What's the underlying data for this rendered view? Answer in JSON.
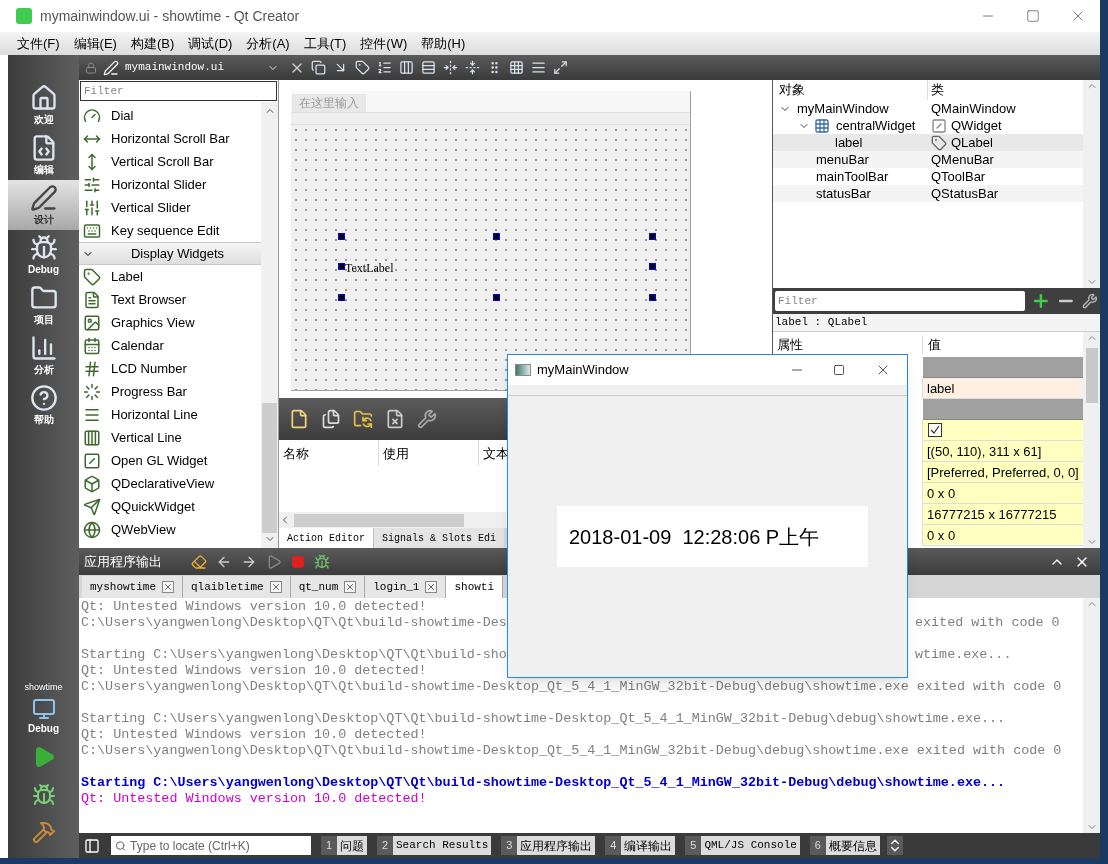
{
  "window": {
    "title": "mymainwindow.ui - showtime - Qt Creator"
  },
  "menu": [
    "文件(F)",
    "编辑(E)",
    "构建(B)",
    "调试(D)",
    "分析(A)",
    "工具(T)",
    "控件(W)",
    "帮助(H)"
  ],
  "mode_bar": {
    "items": [
      {
        "label": "欢迎",
        "selected": false
      },
      {
        "label": "编辑",
        "selected": false
      },
      {
        "label": "设计",
        "selected": true
      },
      {
        "label": "Debug",
        "selected": false
      },
      {
        "label": "项目",
        "selected": false
      },
      {
        "label": "分析",
        "selected": false
      },
      {
        "label": "帮助",
        "selected": false
      }
    ],
    "kit": {
      "project": "showtime",
      "config": "Debug"
    }
  },
  "editor_toolbar": {
    "file": "mymainwindow.ui"
  },
  "widget_box": {
    "filter": {
      "placeholder": "Filter"
    },
    "items": [
      {
        "kind": "widget",
        "label": "Dial"
      },
      {
        "kind": "widget",
        "label": "Horizontal Scroll Bar"
      },
      {
        "kind": "widget",
        "label": "Vertical Scroll Bar"
      },
      {
        "kind": "widget",
        "label": "Horizontal Slider"
      },
      {
        "kind": "widget",
        "label": "Vertical Slider"
      },
      {
        "kind": "widget",
        "label": "Key sequence Edit"
      },
      {
        "kind": "category",
        "label": "Display Widgets",
        "expanded": true
      },
      {
        "kind": "widget",
        "label": "Label"
      },
      {
        "kind": "widget",
        "label": "Text Browser"
      },
      {
        "kind": "widget",
        "label": "Graphics View"
      },
      {
        "kind": "widget",
        "label": "Calendar"
      },
      {
        "kind": "widget",
        "label": "LCD Number"
      },
      {
        "kind": "widget",
        "label": "Progress Bar"
      },
      {
        "kind": "widget",
        "label": "Horizontal Line"
      },
      {
        "kind": "widget",
        "label": "Vertical Line"
      },
      {
        "kind": "widget",
        "label": "Open GL Widget"
      },
      {
        "kind": "widget",
        "label": "QDeclarativeView"
      },
      {
        "kind": "widget",
        "label": "QQuickWidget"
      },
      {
        "kind": "widget",
        "label": "QWebView"
      }
    ]
  },
  "form": {
    "menu_placeholder": "在这里输入",
    "label_text": "TextLabel"
  },
  "action_editor": {
    "columns": [
      "名称",
      "使用",
      "文本"
    ],
    "tabs": [
      {
        "label": "Action Editor",
        "selected": true
      },
      {
        "label": "Signals & Slots Edi",
        "selected": false
      }
    ]
  },
  "object_inspector": {
    "columns": [
      "对象",
      "类"
    ],
    "items": [
      {
        "name": "myMainWindow",
        "class": "QMainWindow",
        "expanded": true,
        "selected": false,
        "children": [
          {
            "name": "centralWidget",
            "class": "QWidget",
            "expanded": true,
            "selected": false,
            "children": [
              {
                "name": "label",
                "class": "QLabel",
                "selected": true
              }
            ]
          },
          {
            "name": "menuBar",
            "class": "QMenuBar",
            "selected": false
          },
          {
            "name": "mainToolBar",
            "class": "QToolBar",
            "selected": false
          },
          {
            "name": "statusBar",
            "class": "QStatusBar",
            "selected": false
          }
        ]
      }
    ]
  },
  "property_editor": {
    "filter": {
      "placeholder": "Filter"
    },
    "object": "label : QLabel",
    "columns": [
      "属性",
      "值"
    ],
    "rows": [
      {
        "kind": "group"
      },
      {
        "kind": "value",
        "value": "label",
        "color": "#fdefe2"
      },
      {
        "kind": "group"
      },
      {
        "kind": "checkbox",
        "checked": true,
        "color": "#ffffc0"
      },
      {
        "kind": "value",
        "value": "[(50, 110), 311 x 61]",
        "color": "#ffffc0"
      },
      {
        "kind": "value",
        "value": "[Preferred, Preferred, 0, 0]",
        "color": "#ffffc0"
      },
      {
        "kind": "value",
        "value": "0 x 0",
        "color": "#ffffc0"
      },
      {
        "kind": "value",
        "value": "16777215 x 16777215",
        "color": "#ffffc0"
      },
      {
        "kind": "value",
        "value": "0 x 0",
        "color": "#ffffc0"
      }
    ]
  },
  "output": {
    "title": "应用程序输出",
    "tabs": [
      {
        "label": "myshowtime",
        "selected": false
      },
      {
        "label": "qlaibletime",
        "selected": false
      },
      {
        "label": "qt_num",
        "selected": false
      },
      {
        "label": "login_1",
        "selected": false
      },
      {
        "label": "showti",
        "selected": true
      }
    ],
    "lines": [
      {
        "kind": "text",
        "text": "Qt: Untested Windows version 10.0 detected!",
        "color": "#808080"
      },
      {
        "kind": "text",
        "text": "C:\\Users\\yangwenlong\\Desktop\\QT\\Qt\\build-showtime-Des",
        "right_text": "exited with code 0",
        "color": "#808080"
      },
      {
        "kind": "blank"
      },
      {
        "kind": "text",
        "text": "Starting C:\\Users\\yangwenlong\\Desktop\\QT\\Qt\\build-sho",
        "right_text": "wtime.exe...",
        "color": "#808080"
      },
      {
        "kind": "text",
        "text": "Qt: Untested Windows version 10.0 detected!",
        "color": "#808080"
      },
      {
        "kind": "text",
        "text": "C:\\Users\\yangwenlong\\Desktop\\QT\\Qt\\build-showtime-Desktop_Qt_5_4_1_MinGW_32bit-Debug\\debug\\showtime.exe exited with code 0",
        "color": "#808080"
      },
      {
        "kind": "blank"
      },
      {
        "kind": "text",
        "text": "Starting C:\\Users\\yangwenlong\\Desktop\\QT\\Qt\\build-showtime-Desktop_Qt_5_4_1_MinGW_32bit-Debug\\debug\\showtime.exe...",
        "color": "#808080"
      },
      {
        "kind": "text",
        "text": "Qt: Untested Windows version 10.0 detected!",
        "color": "#808080"
      },
      {
        "kind": "text",
        "text": "C:\\Users\\yangwenlong\\Desktop\\QT\\Qt\\build-showtime-Desktop_Qt_5_4_1_MinGW_32bit-Debug\\debug\\showtime.exe exited with code 0",
        "color": "#808080"
      },
      {
        "kind": "blank"
      },
      {
        "kind": "text",
        "text": "Starting C:\\Users\\yangwenlong\\Desktop\\QT\\Qt\\build-showtime-Desktop_Qt_5_4_1_MinGW_32bit-Debug\\debug\\showtime.exe...",
        "color": "#0000c8",
        "bold": true
      },
      {
        "kind": "text",
        "text": "Qt: Untested Windows version 10.0 detected!",
        "color": "#cc00cc"
      }
    ]
  },
  "status_bar": {
    "locate": {
      "placeholder": "Type to locate (Ctrl+K)"
    },
    "panes": [
      {
        "number": "1",
        "label": "问题"
      },
      {
        "number": "2",
        "label": "Search Results"
      },
      {
        "number": "3",
        "label": "应用程序输出"
      },
      {
        "number": "4",
        "label": "编译输出"
      },
      {
        "number": "5",
        "label": "QML/JS Console"
      },
      {
        "number": "6",
        "label": "概要信息"
      }
    ]
  },
  "run_window": {
    "title": "myMainWindow",
    "label": "2018-01-09  12:28:06 P上午"
  }
}
